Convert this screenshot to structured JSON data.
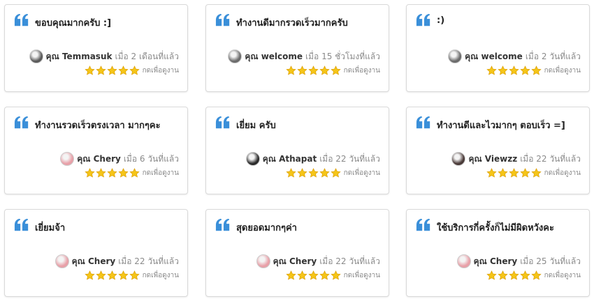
{
  "theme": {
    "quote_color": "#3a8fd9",
    "star_color": "#f5c518",
    "star_outline": "#d99a00"
  },
  "reviews": [
    {
      "text": "ขอบคุณมากครับ :]",
      "name": "คุณ Temmasuk",
      "time": "เมื่อ 2 เดือนที่แล้ว",
      "rating": 5,
      "link": "กดเพื่อดูงาน",
      "avatar_color": "#5a5a5a"
    },
    {
      "text": "ทำงานดีมากรวดเร็วมากครับ",
      "name": "คุณ welcome",
      "time": "เมื่อ 15 ชั่วโมงที่แล้ว",
      "rating": 5,
      "link": "กดเพื่อดูงาน",
      "avatar_color": "#6b6b6b"
    },
    {
      "text": ":)",
      "name": "คุณ welcome",
      "time": "เมื่อ 2 วันที่แล้ว",
      "rating": 5,
      "link": "กดเพื่อดูงาน",
      "avatar_color": "#6b6b6b"
    },
    {
      "text": "ทำงานรวดเร็วตรงเวลา มากๆคะ",
      "name": "คุณ Chery",
      "time": "เมื่อ 6 วันที่แล้ว",
      "rating": 5,
      "link": "กดเพื่อดูงาน",
      "avatar_color": "#e8a0a8"
    },
    {
      "text": "เยี่ยม ครับ",
      "name": "คุณ Athapat",
      "time": "เมื่อ 22 วันที่แล้ว",
      "rating": 5,
      "link": "กดเพื่อดูงาน",
      "avatar_color": "#2a2a2a"
    },
    {
      "text": "ทำงานดีและไวมากๆ ตอบเร็ว =]",
      "name": "คุณ Viewzz",
      "time": "เมื่อ 22 วันที่แล้ว",
      "rating": 5,
      "link": "กดเพื่อดูงาน",
      "avatar_color": "#4a3a38"
    },
    {
      "text": "เยี่ยมจ้า",
      "name": "คุณ Chery",
      "time": "เมื่อ 22 วันที่แล้ว",
      "rating": 5,
      "link": "กดเพื่อดูงาน",
      "avatar_color": "#e8a0a8"
    },
    {
      "text": "สุดยอดมากๆค่า",
      "name": "คุณ Chery",
      "time": "เมื่อ 22 วันที่แล้ว",
      "rating": 5,
      "link": "กดเพื่อดูงาน",
      "avatar_color": "#e8a0a8"
    },
    {
      "text": "ใช้บริการกี่ครั้งก็ไม่มีผิดหวังคะ",
      "name": "คุณ Chery",
      "time": "เมื่อ 25 วันที่แล้ว",
      "rating": 5,
      "link": "กดเพื่อดูงาน",
      "avatar_color": "#e8a0a8"
    }
  ]
}
